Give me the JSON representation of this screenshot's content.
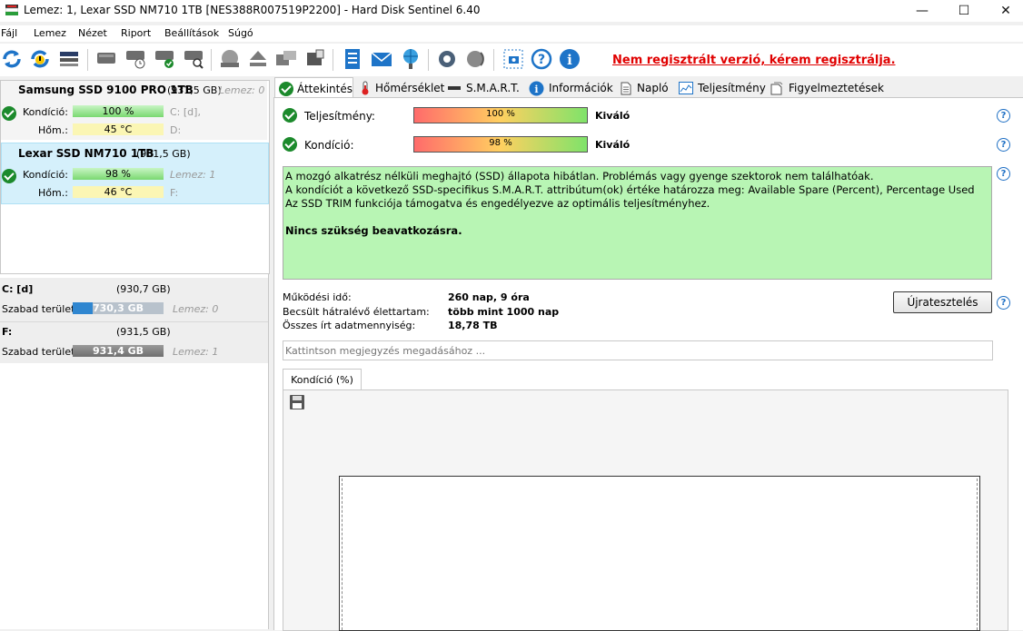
{
  "window": {
    "title": "Lemez: 1, Lexar SSD NM710 1TB [NES388R007519P2200]  -  Hard Disk Sentinel 6.40",
    "minimize": "—",
    "maximize": "☐",
    "close": "✕"
  },
  "menu": [
    "Fájl",
    "Lemez",
    "Nézet",
    "Riport",
    "Beállítások",
    "Súgó"
  ],
  "registration_notice": "Nem regisztrált verzió, kérem regisztrálja.",
  "disks": [
    {
      "name": "Samsung SSD 9100 PRO 1TB",
      "size": "(931,5 GB)",
      "side": "Lemez: 0",
      "condition_label": "Kondíció:",
      "condition_value": "100 %",
      "condition_pct": 100,
      "drive_letters": "C: [d],",
      "temp_label": "Hőm.:",
      "temp_value": "45 °C",
      "temp_drive": "D:"
    },
    {
      "name": "Lexar SSD NM710 1TB",
      "size": "(931,5 GB)",
      "side": "Lemez: 1",
      "condition_label": "Kondíció:",
      "condition_value": "98 %",
      "condition_pct": 98,
      "drive_letters": "",
      "temp_label": "Hőm.:",
      "temp_value": "46 °C",
      "temp_drive": "F:"
    }
  ],
  "volumes": [
    {
      "name": "C: [d]",
      "size": "(930,7 GB)",
      "free_label": "Szabad terület",
      "free_value": "730,3 GB",
      "disk": "Lemez: 0"
    },
    {
      "name": "F:",
      "size": "(931,5 GB)",
      "free_label": "Szabad terület",
      "free_value": "931,4 GB",
      "disk": "Lemez: 1"
    }
  ],
  "tabs": [
    "Áttekintés",
    "Hőmérséklet",
    "S.M.A.R.T.",
    "Információk",
    "Napló",
    "Teljesítmény",
    "Figyelmeztetések"
  ],
  "overview": {
    "performance_label": "Teljesítmény:",
    "performance_value": "100 %",
    "performance_pct": 100,
    "performance_rating": "Kiváló",
    "condition_label": "Kondíció:",
    "condition_value": "98 %",
    "condition_pct": 98,
    "condition_rating": "Kiváló",
    "message_lines": [
      "A mozgó alkatrész nélküli meghajtó (SSD) állapota hibátlan. Problémás vagy gyenge szektorok nem találhatóak.",
      "A kondíciót a következő SSD-specifikus S.M.A.R.T. attribútum(ok) értéke határozza meg:  Available Spare (Percent), Percentage Used",
      "Az SSD TRIM funkciója támogatva és engedélyezve az optimális teljesítményhez."
    ],
    "message_action": "Nincs szükség beavatkozásra.",
    "uptime_label": "Működési idő:",
    "uptime_value": "260 nap, 9 óra",
    "lifetime_label": "Becsült hátralévő élettartam:",
    "lifetime_value": "több mint 1000 nap",
    "written_label": "Összes írt adatmennyiség:",
    "written_value": "18,78 TB",
    "retest_button": "Újratesztelés",
    "note_placeholder": "Kattintson megjegyzés megadásához ...",
    "graph_tab": "Kondíció  (%)"
  }
}
